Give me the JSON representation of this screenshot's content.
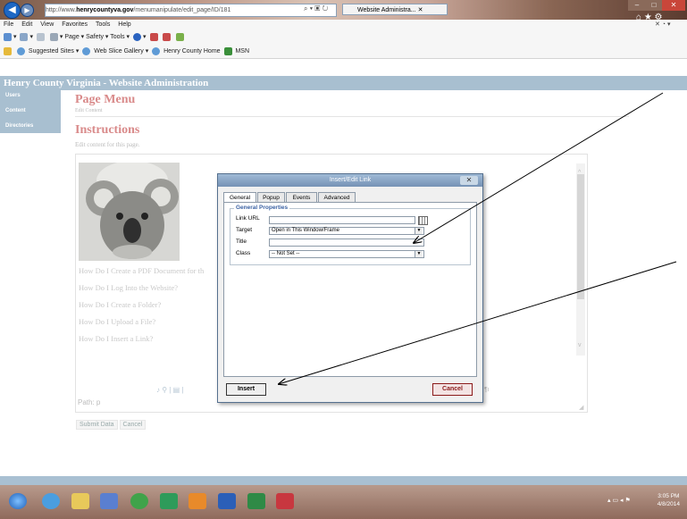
{
  "browser": {
    "url_prefix": "http://www.",
    "url_host": "henrycountyva.gov",
    "url_path": "/menumanipulate/edit_page/ID/181",
    "tab_title": "Website Administra...",
    "menu": [
      "File",
      "Edit",
      "View",
      "Favorites",
      "Tools",
      "Help"
    ],
    "commands": [
      "Page ▾",
      "Safety ▾",
      "Tools ▾"
    ],
    "favorites": [
      "Suggested Sites ▾",
      "Web Slice Gallery ▾",
      "Henry County Home",
      "MSN"
    ]
  },
  "site": {
    "header": "Henry County Virginia - Website Administration",
    "nav": [
      "Users",
      "Content",
      "Directories"
    ]
  },
  "page": {
    "title": "Page Menu",
    "subtitle": "Edit Content",
    "instructions_title": "Instructions",
    "instructions_text": "Edit content for this page."
  },
  "editor": {
    "links": [
      "How Do I Create a PDF Document for th",
      "How Do I Log Into the Website?",
      "How Do I Create a Folder?",
      "How Do I Upload a File?",
      "How Do I Insert a Link?"
    ],
    "path": "Path: p",
    "buttons": [
      "Submit Data",
      "Cancel"
    ]
  },
  "dialog": {
    "title": "Insert/Edit Link",
    "close": "✕",
    "tabs": [
      "General",
      "Popup",
      "Events",
      "Advanced"
    ],
    "legend": "General Properties",
    "fields": {
      "link_url_label": "Link URL",
      "target_label": "Target",
      "target_value": "Open in This Window/Frame",
      "title_label": "Title",
      "class_label": "Class",
      "class_value": "-- Not Set --"
    },
    "insert_label": "Insert",
    "cancel_label": "Cancel"
  },
  "taskbar": {
    "time": "3:05 PM",
    "date": "4/8/2014"
  },
  "colors": {
    "site_header": "#a8bfd0",
    "title_pink": "#d98a8a",
    "dialog_title": "#7592b5",
    "cancel_red": "#8b1a1a"
  }
}
